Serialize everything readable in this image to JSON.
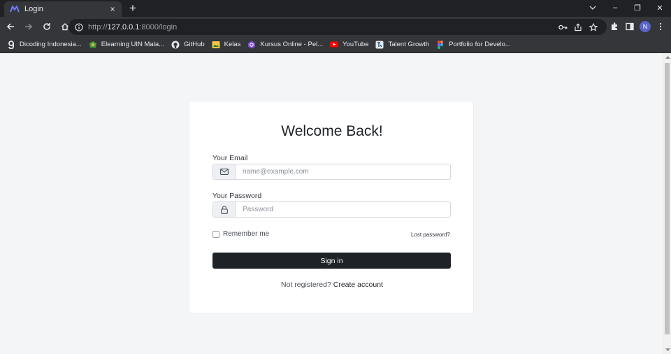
{
  "browser": {
    "tab": {
      "title": "Login",
      "close": "×"
    },
    "new_tab": "+",
    "window_controls": {
      "minimize": "–",
      "maximize": "❐",
      "close": "✕",
      "tab_search": "⌄"
    },
    "url": {
      "prefix": "http://",
      "host": "127.0.0.1",
      "rest": ":8000/login"
    },
    "profile_initial": "N",
    "bookmarks": [
      {
        "label": "Dicoding Indonesia...",
        "icon": "dicoding-icon"
      },
      {
        "label": "Elearning UIN Mala...",
        "icon": "uin-icon"
      },
      {
        "label": "GitHub",
        "icon": "github-icon"
      },
      {
        "label": "Kelas",
        "icon": "kelas-icon"
      },
      {
        "label": "Kursus Online - Pel...",
        "icon": "kursus-icon"
      },
      {
        "label": "YouTube",
        "icon": "youtube-icon"
      },
      {
        "label": "Talent Growth",
        "icon": "talent-icon"
      },
      {
        "label": "Portfolio for Develo...",
        "icon": "figma-icon"
      }
    ]
  },
  "login": {
    "title": "Welcome Back!",
    "email_label": "Your Email",
    "email_placeholder": "name@example.com",
    "password_label": "Your Password",
    "password_placeholder": "Password",
    "remember_label": "Remember me",
    "lost_password": "Lost password?",
    "signin_label": "Sign in",
    "not_registered": "Not registered?",
    "create_account": "Create account"
  }
}
